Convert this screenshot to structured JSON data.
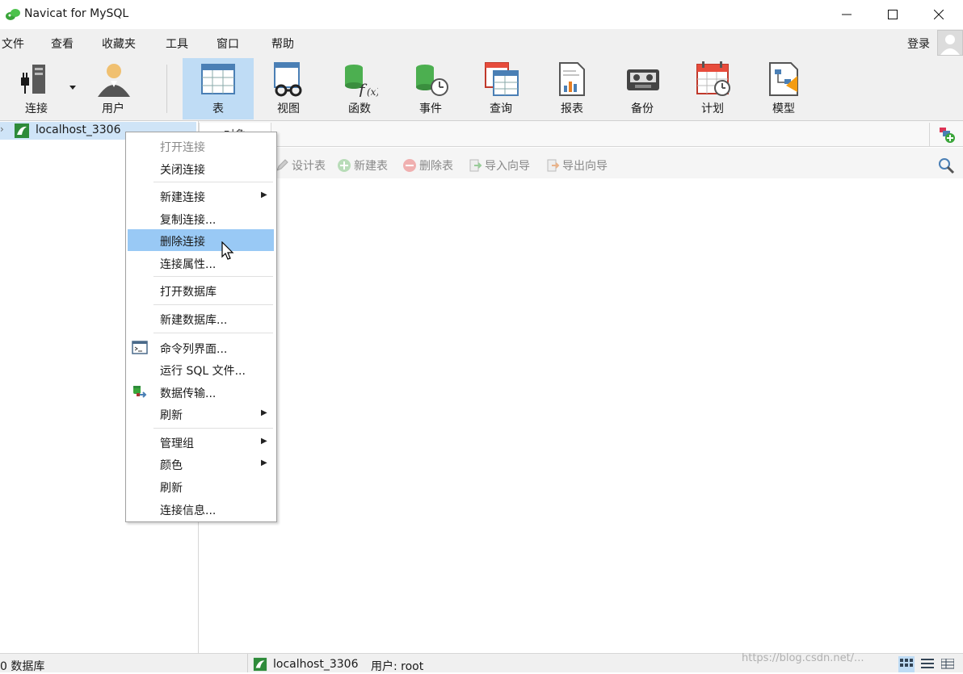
{
  "window": {
    "title": "Navicat for MySQL"
  },
  "menu": {
    "items": [
      "文件",
      "查看",
      "收藏夹",
      "工具",
      "窗口",
      "帮助"
    ],
    "login": "登录"
  },
  "toolbar": {
    "connect": "连接",
    "user": "用户",
    "table": "表",
    "view": "视图",
    "function": "函数",
    "event": "事件",
    "query": "查询",
    "report": "报表",
    "backup": "备份",
    "schedule": "计划",
    "model": "模型"
  },
  "sidebar": {
    "connection_name": "localhost_3306"
  },
  "tabs": {
    "objects": "对象"
  },
  "object_toolbar": {
    "design_table": "设计表",
    "new_table": "新建表",
    "delete_table": "删除表",
    "import_wizard": "导入向导",
    "export_wizard": "导出向导"
  },
  "context_menu": {
    "items": [
      {
        "label": "打开连接",
        "enabled": false
      },
      {
        "label": "关闭连接"
      },
      {
        "label": "新建连接",
        "submenu": true
      },
      {
        "label": "复制连接..."
      },
      {
        "label": "删除连接",
        "highlighted": true
      },
      {
        "label": "连接属性..."
      },
      {
        "label": "打开数据库"
      },
      {
        "label": "新建数据库..."
      },
      {
        "label": "命令列界面...",
        "icon": "terminal-icon"
      },
      {
        "label": "运行 SQL 文件..."
      },
      {
        "label": "数据传输...",
        "icon": "data-transfer-icon"
      },
      {
        "label": "刷新",
        "submenu": true
      },
      {
        "label": "管理组",
        "submenu": true
      },
      {
        "label": "颜色",
        "submenu": true
      },
      {
        "label": "刷新"
      },
      {
        "label": "连接信息..."
      }
    ]
  },
  "status": {
    "db": "0 数据库",
    "connection": "localhost_3306",
    "user": "用户: root",
    "watermark": "https://blog.csdn.net/..."
  },
  "colors": {
    "accent": "#bfdcf5",
    "highlight": "#99c9f5",
    "brand_green": "#3aa53a"
  }
}
